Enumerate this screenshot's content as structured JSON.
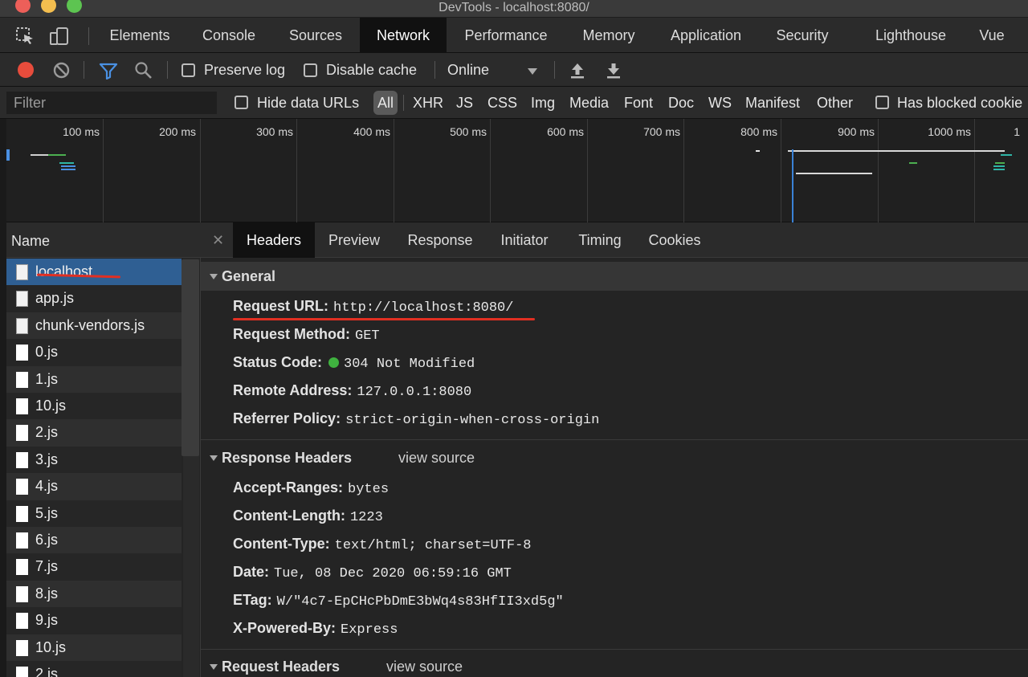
{
  "window": {
    "title": "DevTools - localhost:8080/"
  },
  "tabs": [
    "Elements",
    "Console",
    "Sources",
    "Network",
    "Performance",
    "Memory",
    "Application",
    "Security",
    "Lighthouse",
    "Vue"
  ],
  "active_tab": "Network",
  "toolbar": {
    "preserve_log": "Preserve log",
    "disable_cache": "Disable cache",
    "throttle_value": "Online"
  },
  "filterbar": {
    "placeholder": "Filter",
    "hide_data_urls": "Hide data URLs",
    "all": "All",
    "types": [
      "XHR",
      "JS",
      "CSS",
      "Img",
      "Media",
      "Font",
      "Doc",
      "WS",
      "Manifest",
      "Other"
    ],
    "has_blocked": "Has blocked cookie"
  },
  "overview": {
    "ticks": [
      "100 ms",
      "200 ms",
      "300 ms",
      "400 ms",
      "500 ms",
      "600 ms",
      "700 ms",
      "800 ms",
      "900 ms",
      "1000 ms",
      "1"
    ]
  },
  "name_column": {
    "header": "Name",
    "files": [
      "localhost",
      "app.js",
      "chunk-vendors.js",
      "0.js",
      "1.js",
      "10.js",
      "2.js",
      "3.js",
      "4.js",
      "5.js",
      "6.js",
      "7.js",
      "8.js",
      "9.js",
      "10.js",
      "2.js"
    ],
    "selected": "localhost"
  },
  "details": {
    "tabs": [
      "Headers",
      "Preview",
      "Response",
      "Initiator",
      "Timing",
      "Cookies"
    ],
    "active_tab": "Headers",
    "general": {
      "title": "General",
      "rows": [
        {
          "k": "Request URL:",
          "v": "http://localhost:8080/"
        },
        {
          "k": "Request Method:",
          "v": "GET"
        },
        {
          "k": "Status Code:",
          "v": "304 Not Modified"
        },
        {
          "k": "Remote Address:",
          "v": "127.0.0.1:8080"
        },
        {
          "k": "Referrer Policy:",
          "v": "strict-origin-when-cross-origin"
        }
      ]
    },
    "response_headers": {
      "title": "Response Headers",
      "view_source": "view source",
      "rows": [
        {
          "k": "Accept-Ranges:",
          "v": "bytes"
        },
        {
          "k": "Content-Length:",
          "v": "1223"
        },
        {
          "k": "Content-Type:",
          "v": "text/html; charset=UTF-8"
        },
        {
          "k": "Date:",
          "v": "Tue, 08 Dec 2020 06:59:16 GMT"
        },
        {
          "k": "ETag:",
          "v": "W/\"4c7-EpCHcPbDmE3bWq4s83HfII3xd5g\""
        },
        {
          "k": "X-Powered-By:",
          "v": "Express"
        }
      ]
    },
    "request_headers": {
      "title": "Request Headers",
      "view_source": "view source"
    }
  },
  "colors": {
    "accent_selected": "#2f5f93",
    "record_red": "#e74c3c",
    "status_green": "#3fb23f",
    "annotation_red": "#e12f22",
    "filter_blue": "#4a90e2"
  }
}
